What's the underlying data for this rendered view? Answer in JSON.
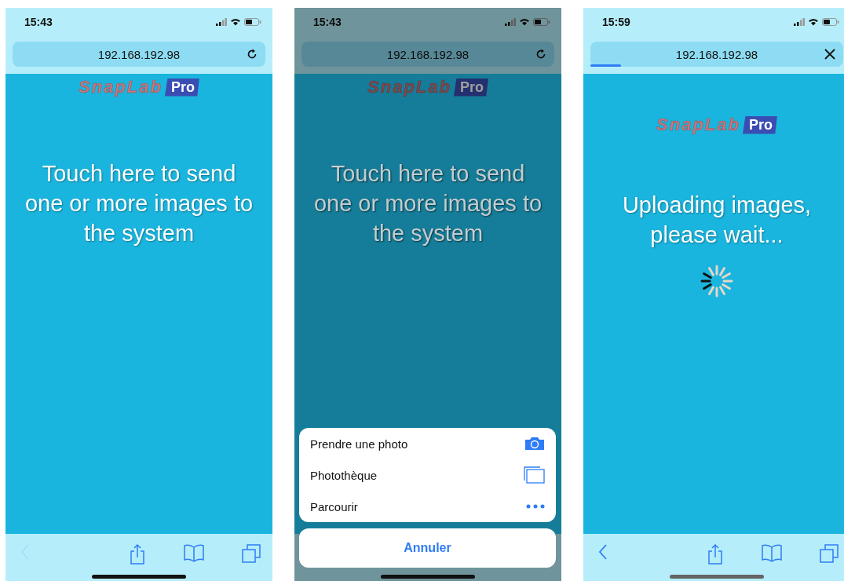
{
  "screens": [
    {
      "kind": "prompt",
      "dimmed": false,
      "status": {
        "time": "15:43"
      },
      "address": {
        "url": "192.168.192.98",
        "loading": false
      },
      "logo": {
        "name": "SnapLab",
        "badge": "Pro"
      },
      "message_lines": [
        "Touch here to send",
        "one or more images to",
        "the system"
      ],
      "toolbar": {
        "back_enabled": false
      }
    },
    {
      "kind": "prompt",
      "dimmed": true,
      "status": {
        "time": "15:43"
      },
      "address": {
        "url": "192.168.192.98",
        "loading": false
      },
      "logo": {
        "name": "SnapLab",
        "badge": "Pro"
      },
      "message_lines": [
        "Touch here to send",
        "one or more images to",
        "the system"
      ],
      "sheet": {
        "options": [
          {
            "label": "Prendre une photo",
            "kind": "camera"
          },
          {
            "label": "Photothèque",
            "kind": "library"
          },
          {
            "label": "Parcourir",
            "kind": "more"
          }
        ],
        "cancel": "Annuler"
      }
    },
    {
      "kind": "upload",
      "dimmed": false,
      "status": {
        "time": "15:59"
      },
      "address": {
        "url": "192.168.192.98",
        "loading": true,
        "level": 0.12
      },
      "logo": {
        "name": "SnapLab",
        "badge": "Pro"
      },
      "message_lines": [
        "Uploading images,",
        "please wait..."
      ],
      "toolbar": {
        "back_enabled": true
      }
    }
  ]
}
